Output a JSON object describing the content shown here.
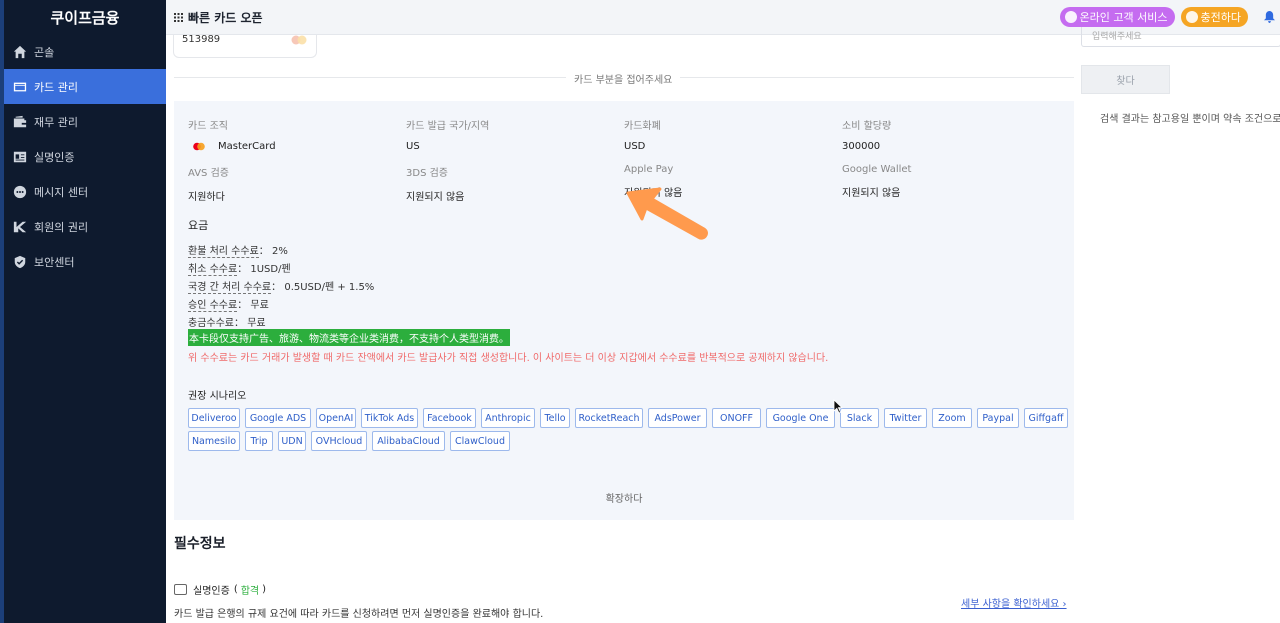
{
  "sidebar": {
    "brand": "쿠이프금융",
    "items": [
      {
        "label": "곤솔",
        "icon": "home-icon"
      },
      {
        "label": "카드 관리",
        "icon": "card-icon",
        "active": true
      },
      {
        "label": "재무 관리",
        "icon": "wallet-icon"
      },
      {
        "label": "실명인증",
        "icon": "id-card-icon"
      },
      {
        "label": "메시지 센터",
        "icon": "message-icon"
      },
      {
        "label": "회원의 권리",
        "icon": "vip-icon"
      },
      {
        "label": "보안센터",
        "icon": "shield-icon"
      }
    ]
  },
  "topbar": {
    "title": "빠른 카드 오픈",
    "service_button": "온라인 고객 서비스",
    "recharge_button": "충전하다"
  },
  "card": {
    "number": "513989",
    "fold_text": "카드 부분을 접어주세요"
  },
  "info": [
    {
      "label": "카드 조직",
      "value": "MasterCard"
    },
    {
      "label": "카드 발급 국가/지역",
      "value": "US"
    },
    {
      "label": "카드화폐",
      "value": "USD"
    },
    {
      "label": "소비 할당량",
      "value": "300000"
    },
    {
      "label": "AVS 검증",
      "value": "지원하다"
    },
    {
      "label": "3DS 검증",
      "value": "지원되지 않음"
    },
    {
      "label": "Apple Pay",
      "value": "지원되지 않음"
    },
    {
      "label": "Google Wallet",
      "value": "지원되지 않음"
    }
  ],
  "fees": {
    "title": "요금",
    "rows": [
      {
        "key": "환불 처리 수수료",
        "value": "2%"
      },
      {
        "key": "취소 수수료",
        "value": "1USD/펜"
      },
      {
        "key": "국경 간 처리 수수료",
        "value": "0.5USD/펜 + 1.5%"
      },
      {
        "key": "승인 수수료",
        "value": "무료"
      },
      {
        "key": "충금수수료",
        "value": "무료"
      }
    ],
    "green_note": "本卡段仅支持广告、旅游、物流类等企业类消费，不支持个人类型消费。",
    "red_note": "위 수수료는 카드 거래가 발생할 때 카드 잔액에서 카드 발급사가 직접 생성합니다. 이 사이트는 더 이상 지갑에서 수수료를 반복적으로 공제하지 않습니다."
  },
  "scenarios": {
    "title": "권장 시나리오",
    "chips": [
      "Deliveroo",
      "Google ADS",
      "OpenAI",
      "TikTok Ads",
      "Facebook",
      "Anthropic",
      "Tello",
      "RocketReach",
      "AdsPower",
      "ONOFF",
      "Google One",
      "Slack",
      "Twitter",
      "Zoom",
      "Paypal",
      "Giffgaff",
      "Namesilo",
      "Trip",
      "UDN",
      "OVHcloud",
      "AlibabaCloud",
      "ClawCloud"
    ],
    "expand": "확장하다"
  },
  "required": {
    "title": "필수정보",
    "verify_label": "실명인증",
    "verify_status_open": "(",
    "verify_status": "합격",
    "verify_status_close": ")",
    "verify_desc": "카드 발급 은행의 규제 요건에 따라 카드를 신청하려면 먼저 실명인증을 완료해야 합니다.",
    "detail_link": "세부 사항을 확인하세요 ›"
  },
  "right_panel": {
    "search_placeholder": "입력해주세요",
    "search_button": "찾다",
    "note": "검색 결과는 참고용일 뿐이며 약속 조건으로 사"
  },
  "colors": {
    "sidebar_bg": "#0e1a2e",
    "active": "#3a6fdc",
    "panel_bg": "#f3f6fb",
    "chip_text": "#2f5fc9",
    "green": "#2cae3d",
    "red_note": "#f06a6a",
    "annotation_arrow": "#ff9a4d"
  }
}
